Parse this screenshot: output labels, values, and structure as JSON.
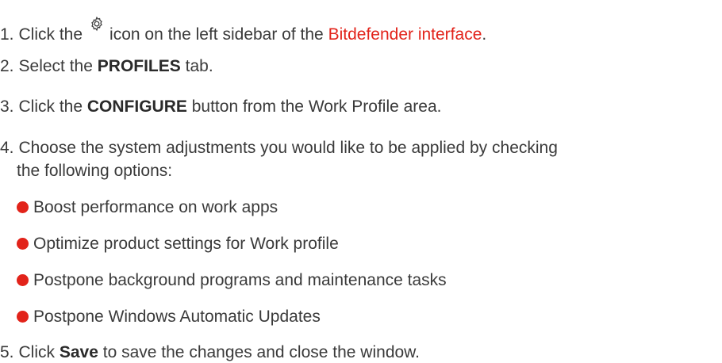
{
  "colors": {
    "accent": "#e2231a",
    "text": "#3a3a3a"
  },
  "steps": {
    "step1": {
      "number": "1.",
      "before_icon": "Click the",
      "icon": "gear-icon",
      "after_icon": "icon on the left sidebar of the",
      "link_text": "Bitdefender interface",
      "end": "."
    },
    "step2": {
      "number": "2.",
      "before": "Select the",
      "bold": "PROFILES",
      "after": "tab."
    },
    "step3": {
      "number": "3.",
      "before": "Click the",
      "bold": "CONFIGURE",
      "after": "button from the Work Profile area."
    },
    "step4": {
      "number": "4.",
      "line1": "Choose the system adjustments you would like to be applied by checking",
      "line2": "the following options:",
      "options": [
        "Boost performance on work apps",
        "Optimize product settings for Work profile",
        "Postpone background programs and maintenance tasks",
        "Postpone Windows Automatic Updates"
      ]
    },
    "step5": {
      "number": "5.",
      "before": "Click",
      "bold": "Save",
      "after": "to save the changes and close the window."
    }
  }
}
